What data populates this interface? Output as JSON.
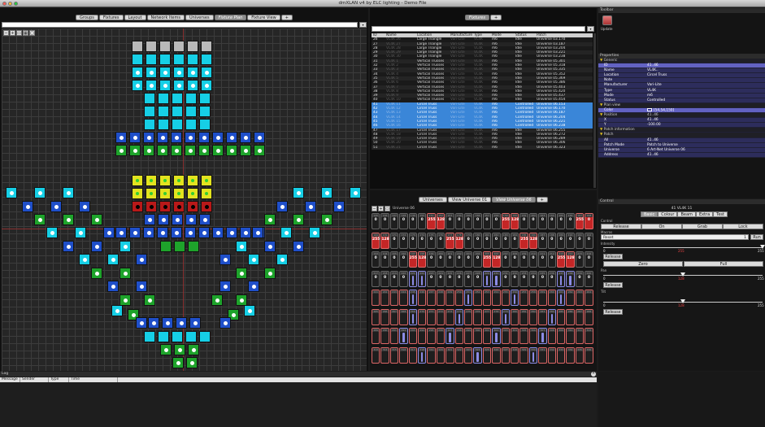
{
  "window": {
    "title": "dmXLAN v4 by ELC lighting - Demo File"
  },
  "left_tabs": {
    "items": [
      {
        "label": "Groups",
        "active": false
      },
      {
        "label": "Fixtures",
        "active": false
      },
      {
        "label": "Layout",
        "active": false
      },
      {
        "label": "Network Items",
        "active": false
      },
      {
        "label": "Universes",
        "active": false
      },
      {
        "label": "Fixture Plan",
        "active": true
      },
      {
        "label": "Fixture View",
        "active": false
      },
      {
        "label": "+",
        "active": false
      }
    ]
  },
  "colors": {
    "cyan": "#16cfe6",
    "blue": "#1f4fc9",
    "green": "#1ea32b",
    "yellow": "#e3e31f",
    "red": "#b81919",
    "gray": "#b9b9b9",
    "selected": "#3a86d8"
  },
  "fixtures_panel": {
    "tab_label": "Fixtures",
    "add_label": "+",
    "columns": [
      "ID",
      "Name",
      "Location",
      "Manufacturer",
      "Type",
      "Mode",
      "Status",
      "Patch"
    ],
    "rows": [
      {
        "id": "26",
        "name": "VL4K 26",
        "location": "Large Triangle",
        "manufacturer": "Vari-Lite",
        "type": "VL4K",
        "mode": "m6",
        "status": "Idle",
        "patch": "Universe 03.170",
        "sel": false
      },
      {
        "id": "27",
        "name": "VL4K 27",
        "location": "Large Triangle",
        "manufacturer": "Vari-Lite",
        "type": "VL4K",
        "mode": "m6",
        "status": "Idle",
        "patch": "Universe 03.187",
        "sel": false
      },
      {
        "id": "28",
        "name": "VL4K 28",
        "location": "Large Triangle",
        "manufacturer": "Vari-Lite",
        "type": "VL4K",
        "mode": "m6",
        "status": "Idle",
        "patch": "Universe 03.204",
        "sel": false
      },
      {
        "id": "29",
        "name": "VL4K 29",
        "location": "Large Triangle",
        "manufacturer": "Vari-Lite",
        "type": "VL4K",
        "mode": "m6",
        "status": "Idle",
        "patch": "Universe 03.221",
        "sel": false
      },
      {
        "id": "30",
        "name": "VL4K 30",
        "location": "Large Triangle",
        "manufacturer": "Vari-Lite",
        "type": "VL4K",
        "mode": "m6",
        "status": "Idle",
        "patch": "Universe 03.238",
        "sel": false
      },
      {
        "id": "31",
        "name": "VL4K 1",
        "location": "Vertical Trusses",
        "manufacturer": "Vari-Lite",
        "type": "VL4K",
        "mode": "m6",
        "status": "Idle",
        "patch": "Universe 05.301",
        "sel": false
      },
      {
        "id": "32",
        "name": "VL4K 2",
        "location": "Vertical Trusses",
        "manufacturer": "Vari-Lite",
        "type": "VL4K",
        "mode": "m6",
        "status": "Idle",
        "patch": "Universe 05.318",
        "sel": false
      },
      {
        "id": "33",
        "name": "VL4K 3",
        "location": "Vertical Trusses",
        "manufacturer": "Vari-Lite",
        "type": "VL4K",
        "mode": "m6",
        "status": "Idle",
        "patch": "Universe 05.335",
        "sel": false
      },
      {
        "id": "34",
        "name": "VL4K 4",
        "location": "Vertical Trusses",
        "manufacturer": "Vari-Lite",
        "type": "VL4K",
        "mode": "m6",
        "status": "Idle",
        "patch": "Universe 05.352",
        "sel": false
      },
      {
        "id": "35",
        "name": "VL4K 5",
        "location": "Vertical Trusses",
        "manufacturer": "Vari-Lite",
        "type": "VL4K",
        "mode": "m6",
        "status": "Idle",
        "patch": "Universe 05.369",
        "sel": false
      },
      {
        "id": "36",
        "name": "VL4K 6",
        "location": "Vertical Trusses",
        "manufacturer": "Vari-Lite",
        "type": "VL4K",
        "mode": "m6",
        "status": "Idle",
        "patch": "Universe 05.386",
        "sel": false
      },
      {
        "id": "37",
        "name": "VL4K 7",
        "location": "Vertical Trusses",
        "manufacturer": "Vari-Lite",
        "type": "VL4K",
        "mode": "m6",
        "status": "Idle",
        "patch": "Universe 05.403",
        "sel": false
      },
      {
        "id": "38",
        "name": "VL4K 8",
        "location": "Vertical Trusses",
        "manufacturer": "Vari-Lite",
        "type": "VL4K",
        "mode": "m6",
        "status": "Idle",
        "patch": "Universe 05.420",
        "sel": false
      },
      {
        "id": "39",
        "name": "VL4K 9",
        "location": "Vertical Trusses",
        "manufacturer": "Vari-Lite",
        "type": "VL4K",
        "mode": "m6",
        "status": "Idle",
        "patch": "Universe 05.437",
        "sel": false
      },
      {
        "id": "40",
        "name": "VL4K 10",
        "location": "Vertical Trusses",
        "manufacturer": "Vari-Lite",
        "type": "VL4K",
        "mode": "m6",
        "status": "Idle",
        "patch": "Universe 05.454",
        "sel": false
      },
      {
        "id": "41",
        "name": "VL4K 11",
        "location": "Circel Truss",
        "manufacturer": "Vari-Lite",
        "type": "VL4K",
        "mode": "m6",
        "status": "Controlled",
        "patch": "Universe 06.153",
        "sel": true
      },
      {
        "id": "42",
        "name": "VL4K 12",
        "location": "Circel Truss",
        "manufacturer": "Vari-Lite",
        "type": "VL4K",
        "mode": "m6",
        "status": "Controlled",
        "patch": "Universe 06.170",
        "sel": true
      },
      {
        "id": "43",
        "name": "VL4K 13",
        "location": "Circel Truss",
        "manufacturer": "Vari-Lite",
        "type": "VL4K",
        "mode": "m6",
        "status": "Controlled",
        "patch": "Universe 06.187",
        "sel": true
      },
      {
        "id": "44",
        "name": "VL4K 14",
        "location": "Circel Truss",
        "manufacturer": "Vari-Lite",
        "type": "VL4K",
        "mode": "m6",
        "status": "Controlled",
        "patch": "Universe 06.204",
        "sel": true
      },
      {
        "id": "45",
        "name": "VL4K 15",
        "location": "Circel Truss",
        "manufacturer": "Vari-Lite",
        "type": "VL4K",
        "mode": "m6",
        "status": "Controlled",
        "patch": "Universe 06.221",
        "sel": true
      },
      {
        "id": "46",
        "name": "VL4K 16",
        "location": "Circel Truss",
        "manufacturer": "Vari-Lite",
        "type": "VL4K",
        "mode": "m6",
        "status": "Controlled",
        "patch": "Universe 06.238",
        "sel": true
      },
      {
        "id": "47",
        "name": "VL4K 17",
        "location": "Circel Truss",
        "manufacturer": "Vari-Lite",
        "type": "VL4K",
        "mode": "m6",
        "status": "Idle",
        "patch": "Universe 06.255",
        "sel": false
      },
      {
        "id": "48",
        "name": "VL4K 18",
        "location": "Circel Truss",
        "manufacturer": "Vari-Lite",
        "type": "VL4K",
        "mode": "m6",
        "status": "Idle",
        "patch": "Universe 06.272",
        "sel": false
      },
      {
        "id": "49",
        "name": "VL4K 19",
        "location": "Circel Truss",
        "manufacturer": "Vari-Lite",
        "type": "VL4K",
        "mode": "m6",
        "status": "Idle",
        "patch": "Universe 06.289",
        "sel": false
      },
      {
        "id": "50",
        "name": "VL4K 20",
        "location": "Circel Truss",
        "manufacturer": "Vari-Lite",
        "type": "VL4K",
        "mode": "m6",
        "status": "Idle",
        "patch": "Universe 06.306",
        "sel": false
      },
      {
        "id": "51",
        "name": "VL4K 21",
        "location": "Circel Truss",
        "manufacturer": "Vari-Lite",
        "type": "VL4K",
        "mode": "m6",
        "status": "Idle",
        "patch": "Universe 06.323",
        "sel": false
      }
    ]
  },
  "toolbar_panel": {
    "title": "Toolbar",
    "update_label": "Update"
  },
  "properties": {
    "title": "Properties",
    "rows": [
      {
        "kind": "cat",
        "k": "Generic",
        "v": ""
      },
      {
        "kind": "item",
        "k": "ID",
        "v": "41..46",
        "sel": true
      },
      {
        "kind": "item",
        "k": "Name",
        "v": "VL4K..",
        "sel": false
      },
      {
        "kind": "item",
        "k": "Location",
        "v": "Circel Truss",
        "sel": false
      },
      {
        "kind": "item",
        "k": "Note",
        "v": "",
        "sel": false
      },
      {
        "kind": "item",
        "k": "Manufacturer",
        "v": "Vari-Lite",
        "sel": false
      },
      {
        "kind": "item",
        "k": "Type",
        "v": "VL4K",
        "sel": false
      },
      {
        "kind": "item",
        "k": "Mode",
        "v": "m6",
        "sel": false
      },
      {
        "kind": "item",
        "k": "Status",
        "v": "Controlled",
        "sel": false
      },
      {
        "kind": "cat",
        "k": "Plan view",
        "v": ""
      },
      {
        "kind": "item",
        "k": "Color",
        "v": "[54,54,150]",
        "sel": true
      },
      {
        "kind": "cat",
        "k": "Position",
        "v": "41..46"
      },
      {
        "kind": "item",
        "k": "X",
        "v": "41..46",
        "sel": false
      },
      {
        "kind": "item",
        "k": "Y",
        "v": "-100.00",
        "sel": false
      },
      {
        "kind": "cat",
        "k": "Patch information",
        "v": ""
      },
      {
        "kind": "cat",
        "k": "Patch",
        "v": ""
      },
      {
        "kind": "item",
        "k": "All",
        "v": "41..46",
        "sel": false
      },
      {
        "kind": "item",
        "k": "Patch Mode",
        "v": "Patch to Universe",
        "sel": false
      },
      {
        "kind": "item",
        "k": "Universe",
        "v": "6 Art-Net Universe 06",
        "sel": false
      },
      {
        "kind": "item",
        "k": "Address",
        "v": "41..46",
        "sel": false
      }
    ]
  },
  "universe_panel": {
    "tabs": [
      {
        "label": "Universes",
        "active": false
      },
      {
        "label": "View Universe 01",
        "active": false
      },
      {
        "label": "View Universe 06",
        "active": true
      },
      {
        "label": "+",
        "active": false
      }
    ],
    "header_label": "Universe 06",
    "rows": [
      {
        "start": 145,
        "types": "nnnnnnrrnnnnnnrrnnnnnnrr",
        "values": [
          "0",
          "0",
          "0",
          "0",
          "0",
          "0",
          "255",
          "128",
          "0",
          "0",
          "0",
          "0",
          "0",
          "0",
          "255",
          "128",
          "0",
          "0",
          "0",
          "0",
          "0",
          "0",
          "255",
          "0"
        ]
      },
      {
        "start": 169,
        "types": "rrnnnnnnrrnnnnnnrrnnnnnn",
        "values": [
          "255",
          "128",
          "0",
          "0",
          "0",
          "0",
          "0",
          "0",
          "255",
          "128",
          "0",
          "0",
          "0",
          "0",
          "0",
          "0",
          "255",
          "128",
          "0",
          "0",
          "0",
          "0",
          "0",
          "0"
        ]
      },
      {
        "start": 193,
        "types": "nnnnrrnnnnnnrrnnnnnnrrnn",
        "values": [
          "0",
          "0",
          "0",
          "0",
          "255",
          "128",
          "0",
          "0",
          "0",
          "0",
          "0",
          "0",
          "255",
          "128",
          "0",
          "0",
          "0",
          "0",
          "0",
          "0",
          "255",
          "128",
          "0",
          "0"
        ]
      },
      {
        "start": 217,
        "types": "nnnnvvnnnnnnvvnnnnnnvvnn",
        "values": [
          "0",
          "0",
          "0",
          "0",
          "",
          "",
          "0",
          "0",
          "0",
          "0",
          "0",
          "0",
          "",
          "",
          "0",
          "0",
          "0",
          "0",
          "0",
          "0",
          "",
          "",
          "0",
          "0"
        ]
      },
      {
        "start": 241,
        "types": "eeeeveeeeeveeeeveeeeveee",
        "values": []
      },
      {
        "start": 265,
        "types": "eeeeveeeeveeeeveeeeveeee",
        "values": []
      },
      {
        "start": 289,
        "types": "eeeveeeeveeeeveeeeveeeee",
        "values": []
      },
      {
        "start": 313,
        "types": "eeeeeveeeeeveeeeeveeeeee",
        "values": []
      }
    ]
  },
  "control": {
    "title": "Control",
    "fixture_label": "41 VL4K 11",
    "tabs": [
      {
        "label": "Basic",
        "active": true
      },
      {
        "label": "Colour",
        "active": false
      },
      {
        "label": "Beam",
        "active": false
      },
      {
        "label": "Extra",
        "active": false
      },
      {
        "label": "Test",
        "active": false
      }
    ],
    "control_label": "Control",
    "control_buttons": [
      "Release",
      "On",
      "Grab",
      "Lock"
    ],
    "macros_label": "Macros",
    "macro_value": "Reset",
    "macro_num": "1",
    "run_label": "Run",
    "intensity_label": "Intensity",
    "intensity": {
      "min": "0",
      "value": "255",
      "max": "255",
      "level": 1.0
    },
    "release_label": "Release",
    "zero_label": "Zero",
    "full_label": "Full",
    "pan_label": "Pan",
    "pan": {
      "min": "0",
      "value": "128",
      "max": "255",
      "level": 0.5
    },
    "tilt_label": "Tilt",
    "tilt": {
      "min": "0",
      "value": "128",
      "max": "255",
      "level": 0.5
    }
  },
  "log": {
    "title": "Log",
    "columns": [
      "Message",
      "Sender",
      "Type",
      "Time"
    ]
  }
}
